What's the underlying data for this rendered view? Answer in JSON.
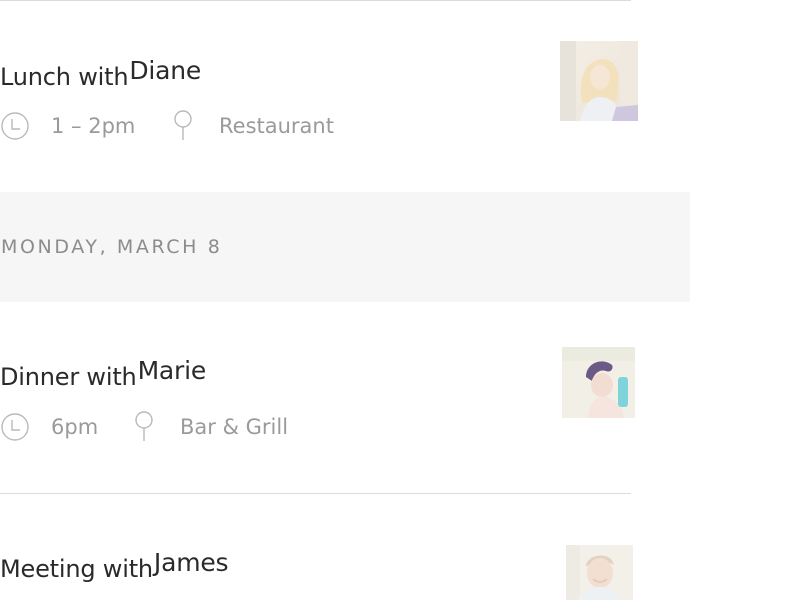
{
  "events_before": [
    {
      "prefix": "Lunch with",
      "person": "Diane",
      "time": "1 – 2pm",
      "location": "Restaurant"
    }
  ],
  "day_header": {
    "label": "MONDAY, MARCH 8"
  },
  "events_after": [
    {
      "prefix": "Dinner with",
      "person": "Marie",
      "time": "6pm",
      "location": "Bar & Grill"
    },
    {
      "prefix": "Meeting with",
      "person": "James"
    }
  ],
  "icons": {
    "time": "clock-icon",
    "location": "location-pin-icon"
  },
  "colors": {
    "divider": "#dcdcdc",
    "day_header_bg": "#f6f6f6",
    "title_text": "#2a2a2a",
    "meta_text": "#9a9a9a",
    "day_header_text": "#8c8c8c"
  }
}
